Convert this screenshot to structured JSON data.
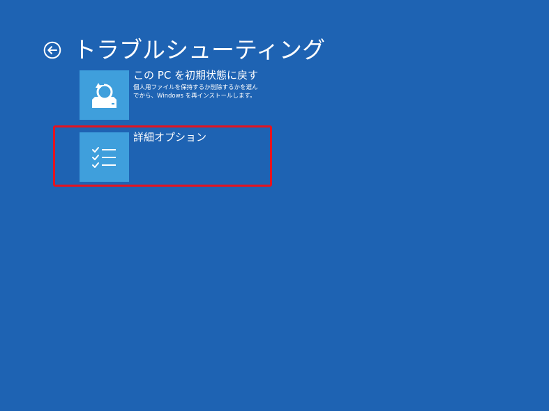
{
  "header": {
    "back_icon": "back-arrow-circle-icon",
    "title": "トラブルシューティング"
  },
  "options": [
    {
      "icon": "reset-pc-icon",
      "title": "この PC を初期状態に戻す",
      "description": "個人用ファイルを保持するか削除するかを選んでから、Windows を再インストールします。"
    },
    {
      "icon": "checklist-icon",
      "title": "詳細オプション",
      "description": ""
    }
  ],
  "colors": {
    "background": "#1e63b3",
    "tile": "#3f9fdc",
    "highlight": "#e5131f",
    "text": "#ffffff"
  }
}
